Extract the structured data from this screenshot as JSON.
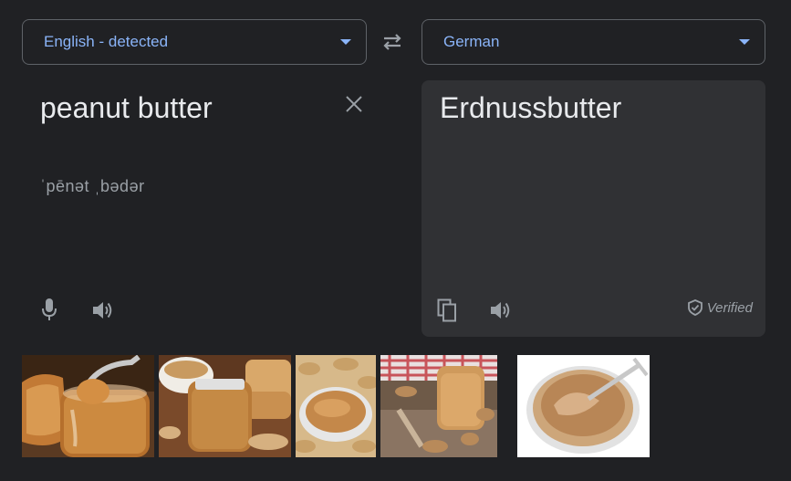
{
  "source": {
    "language": "English - detected",
    "text": "peanut butter",
    "phonetic": "ˈpēnət ˌbədər"
  },
  "target": {
    "language": "German",
    "text": "Erdnussbutter",
    "verified_label": "Verified"
  },
  "icons": {
    "swap": "swap-icon",
    "clear": "close-icon",
    "mic": "microphone-icon",
    "speaker": "speaker-icon",
    "copy": "copy-icon",
    "verified": "shield-check-icon",
    "source_dropdown": "chevron-down-icon"
  },
  "colors": {
    "background": "#202124",
    "panel": "#303134",
    "accent": "#8ab4f8",
    "text": "#e8eaed",
    "muted": "#9aa0a6"
  },
  "images": [
    {
      "name": "peanut-butter-jar-spoon"
    },
    {
      "name": "peanut-butter-jar-bread"
    },
    {
      "name": "peanut-butter-bowl-peanuts"
    },
    {
      "name": "peanut-butter-jar-wood"
    },
    {
      "name": "peanut-butter-jar-fork"
    }
  ]
}
